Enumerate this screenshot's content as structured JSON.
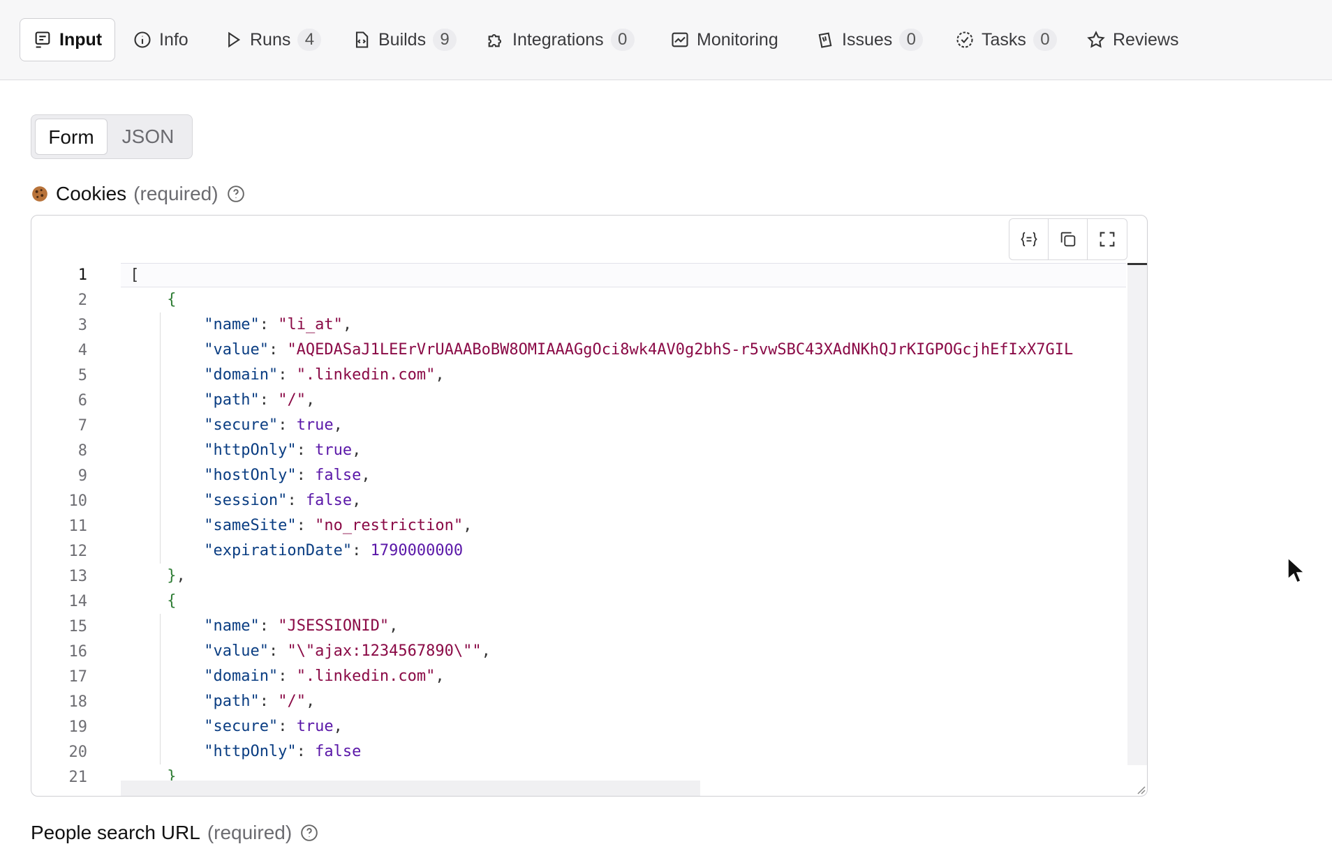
{
  "tabs": [
    {
      "label": "Input",
      "icon": "input-icon",
      "active": true
    },
    {
      "label": "Info",
      "icon": "info-icon"
    },
    {
      "label": "Runs",
      "icon": "play-icon",
      "count": "4"
    },
    {
      "label": "Builds",
      "icon": "file-code-icon",
      "count": "9"
    },
    {
      "label": "Integrations",
      "icon": "puzzle-icon",
      "count": "0"
    },
    {
      "label": "Monitoring",
      "icon": "chart-icon"
    },
    {
      "label": "Issues",
      "icon": "bug-icon",
      "count": "0"
    },
    {
      "label": "Tasks",
      "icon": "task-icon",
      "count": "0"
    },
    {
      "label": "Reviews",
      "icon": "star-icon"
    }
  ],
  "mode_toggle": {
    "form": "Form",
    "json": "JSON"
  },
  "cookies_field": {
    "label": "Cookies",
    "required": "(required)"
  },
  "people_field": {
    "label": "People search URL",
    "required": "(required)"
  },
  "editor": {
    "lines": [
      {
        "n": "1"
      },
      {
        "n": "2"
      },
      {
        "n": "3"
      },
      {
        "n": "4"
      },
      {
        "n": "5"
      },
      {
        "n": "6"
      },
      {
        "n": "7"
      },
      {
        "n": "8"
      },
      {
        "n": "9"
      },
      {
        "n": "10"
      },
      {
        "n": "11"
      },
      {
        "n": "12"
      },
      {
        "n": "13"
      },
      {
        "n": "14"
      },
      {
        "n": "15"
      },
      {
        "n": "16"
      },
      {
        "n": "17"
      },
      {
        "n": "18"
      },
      {
        "n": "19"
      },
      {
        "n": "20"
      },
      {
        "n": "21"
      }
    ],
    "code": [
      {
        "i": 0,
        "t": [
          [
            "p",
            "["
          ]
        ]
      },
      {
        "i": 1,
        "t": [
          [
            "g",
            "{"
          ]
        ]
      },
      {
        "i": 2,
        "t": [
          [
            "k",
            "\"name\""
          ],
          [
            "p",
            ": "
          ],
          [
            "s",
            "\"li_at\""
          ],
          [
            "p",
            ","
          ]
        ]
      },
      {
        "i": 2,
        "t": [
          [
            "k",
            "\"value\""
          ],
          [
            "p",
            ": "
          ],
          [
            "s",
            "\"AQEDASaJ1LEErVrUAAABoBW8OMIAAAGgOci8wk4AV0g2bhS-r5vwSBC43XAdNKhQJrKIGPOGcjhEfIxX7GIL"
          ]
        ]
      },
      {
        "i": 2,
        "t": [
          [
            "k",
            "\"domain\""
          ],
          [
            "p",
            ": "
          ],
          [
            "s",
            "\".linkedin.com\""
          ],
          [
            "p",
            ","
          ]
        ]
      },
      {
        "i": 2,
        "t": [
          [
            "k",
            "\"path\""
          ],
          [
            "p",
            ": "
          ],
          [
            "s",
            "\"/\""
          ],
          [
            "p",
            ","
          ]
        ]
      },
      {
        "i": 2,
        "t": [
          [
            "k",
            "\"secure\""
          ],
          [
            "p",
            ": "
          ],
          [
            "b",
            "true"
          ],
          [
            "p",
            ","
          ]
        ]
      },
      {
        "i": 2,
        "t": [
          [
            "k",
            "\"httpOnly\""
          ],
          [
            "p",
            ": "
          ],
          [
            "b",
            "true"
          ],
          [
            "p",
            ","
          ]
        ]
      },
      {
        "i": 2,
        "t": [
          [
            "k",
            "\"hostOnly\""
          ],
          [
            "p",
            ": "
          ],
          [
            "b",
            "false"
          ],
          [
            "p",
            ","
          ]
        ]
      },
      {
        "i": 2,
        "t": [
          [
            "k",
            "\"session\""
          ],
          [
            "p",
            ": "
          ],
          [
            "b",
            "false"
          ],
          [
            "p",
            ","
          ]
        ]
      },
      {
        "i": 2,
        "t": [
          [
            "k",
            "\"sameSite\""
          ],
          [
            "p",
            ": "
          ],
          [
            "s",
            "\"no_restriction\""
          ],
          [
            "p",
            ","
          ]
        ]
      },
      {
        "i": 2,
        "t": [
          [
            "k",
            "\"expirationDate\""
          ],
          [
            "p",
            ": "
          ],
          [
            "n",
            "1790000000"
          ]
        ]
      },
      {
        "i": 1,
        "t": [
          [
            "g",
            "}"
          ],
          [
            "p",
            ","
          ]
        ]
      },
      {
        "i": 1,
        "t": [
          [
            "g",
            "{"
          ]
        ]
      },
      {
        "i": 2,
        "t": [
          [
            "k",
            "\"name\""
          ],
          [
            "p",
            ": "
          ],
          [
            "s",
            "\"JSESSIONID\""
          ],
          [
            "p",
            ","
          ]
        ]
      },
      {
        "i": 2,
        "t": [
          [
            "k",
            "\"value\""
          ],
          [
            "p",
            ": "
          ],
          [
            "s",
            "\"\\\"ajax:1234567890\\\"\""
          ],
          [
            "p",
            ","
          ]
        ]
      },
      {
        "i": 2,
        "t": [
          [
            "k",
            "\"domain\""
          ],
          [
            "p",
            ": "
          ],
          [
            "s",
            "\".linkedin.com\""
          ],
          [
            "p",
            ","
          ]
        ]
      },
      {
        "i": 2,
        "t": [
          [
            "k",
            "\"path\""
          ],
          [
            "p",
            ": "
          ],
          [
            "s",
            "\"/\""
          ],
          [
            "p",
            ","
          ]
        ]
      },
      {
        "i": 2,
        "t": [
          [
            "k",
            "\"secure\""
          ],
          [
            "p",
            ": "
          ],
          [
            "b",
            "true"
          ],
          [
            "p",
            ","
          ]
        ]
      },
      {
        "i": 2,
        "t": [
          [
            "k",
            "\"httpOnly\""
          ],
          [
            "p",
            ": "
          ],
          [
            "b",
            "false"
          ]
        ]
      },
      {
        "i": 1,
        "t": [
          [
            "g",
            "}"
          ]
        ]
      }
    ]
  },
  "colors": {
    "accent": "#111111",
    "string": "#8a0a46",
    "bool": "#5a17a8",
    "key": "#0a3d82",
    "brace": "#2f7d35"
  }
}
